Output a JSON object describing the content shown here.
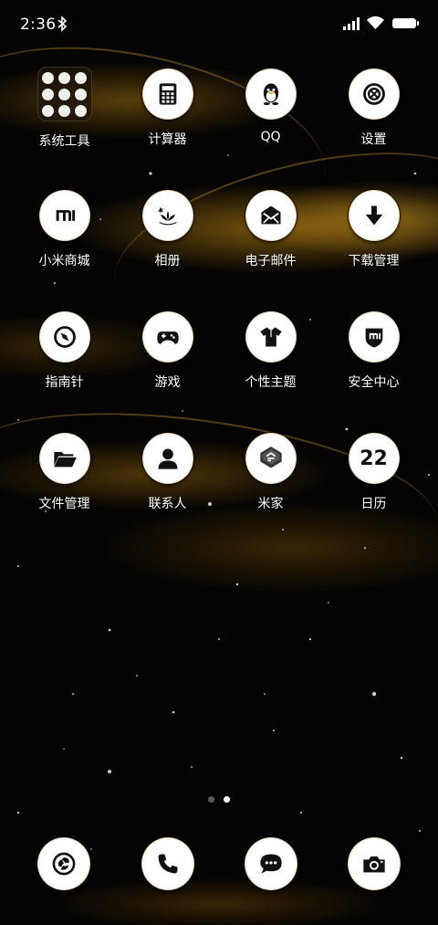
{
  "status_bar": {
    "time": "2:36",
    "bluetooth_icon": "bluetooth-icon",
    "signal_icon": "cellular-signal-icon",
    "wifi_icon": "wifi-icon",
    "battery_icon": "battery-full-icon"
  },
  "apps": [
    {
      "label": "系统工具",
      "icon": "folder-grid-icon"
    },
    {
      "label": "计算器",
      "icon": "calculator-icon"
    },
    {
      "label": "QQ",
      "icon": "qq-penguin-icon"
    },
    {
      "label": "设置",
      "icon": "gear-icon"
    },
    {
      "label": "小米商城",
      "icon": "mi-logo-icon"
    },
    {
      "label": "相册",
      "icon": "gallery-flower-icon"
    },
    {
      "label": "电子邮件",
      "icon": "envelope-icon"
    },
    {
      "label": "下载管理",
      "icon": "download-arrow-icon"
    },
    {
      "label": "指南针",
      "icon": "compass-icon"
    },
    {
      "label": "游戏",
      "icon": "gamepad-icon"
    },
    {
      "label": "个性主题",
      "icon": "tshirt-icon"
    },
    {
      "label": "安全中心",
      "icon": "security-shield-icon"
    },
    {
      "label": "文件管理",
      "icon": "folder-icon"
    },
    {
      "label": "联系人",
      "icon": "person-icon"
    },
    {
      "label": "米家",
      "icon": "mijia-home-icon"
    },
    {
      "label": "日历",
      "icon": "calendar-date-icon",
      "date": "22"
    }
  ],
  "page_indicator": {
    "pages": 2,
    "current": 2
  },
  "dock": [
    {
      "name": "browser",
      "icon": "browser-swirl-icon"
    },
    {
      "name": "phone",
      "icon": "phone-icon"
    },
    {
      "name": "messages",
      "icon": "message-bubble-icon"
    },
    {
      "name": "camera",
      "icon": "camera-icon"
    }
  ],
  "colors": {
    "accent_gold": "#c9a15a",
    "icon_fill": "#111111",
    "background": "#050403"
  }
}
